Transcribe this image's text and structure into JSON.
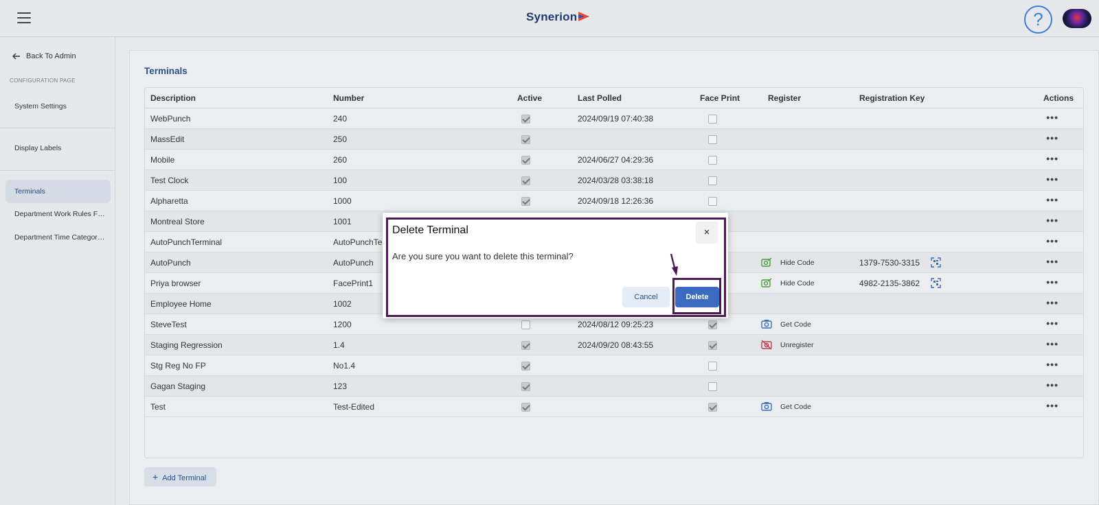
{
  "header": {
    "logo_text": "Synerion",
    "help_symbol": "?"
  },
  "sidebar": {
    "back_label": "Back To Admin",
    "section_label": "CONFIGURATION PAGE",
    "items": [
      {
        "label": "System Settings"
      },
      {
        "label": "Display Labels"
      },
      {
        "label": "Terminals"
      },
      {
        "label": "Department Work Rules Filt..."
      },
      {
        "label": "Department Time Category ..."
      }
    ]
  },
  "main": {
    "title": "Terminals",
    "columns": [
      "Description",
      "Number",
      "Active",
      "Last Polled",
      "Face Print",
      "Register",
      "Registration Key",
      "Actions"
    ],
    "rows": [
      {
        "description": "WebPunch",
        "number": "240",
        "active": true,
        "last_polled": "2024/09/19 07:40:38",
        "face_print": false,
        "register": "",
        "reg_key": ""
      },
      {
        "description": "MassEdit",
        "number": "250",
        "active": true,
        "last_polled": "",
        "face_print": false,
        "register": "",
        "reg_key": ""
      },
      {
        "description": "Mobile",
        "number": "260",
        "active": true,
        "last_polled": "2024/06/27 04:29:36",
        "face_print": false,
        "register": "",
        "reg_key": ""
      },
      {
        "description": "Test Clock",
        "number": "100",
        "active": true,
        "last_polled": "2024/03/28 03:38:18",
        "face_print": false,
        "register": "",
        "reg_key": ""
      },
      {
        "description": "Alpharetta",
        "number": "1000",
        "active": true,
        "last_polled": "2024/09/18 12:26:36",
        "face_print": false,
        "register": "",
        "reg_key": ""
      },
      {
        "description": "Montreal Store",
        "number": "1001",
        "active": null,
        "last_polled": "",
        "face_print": null,
        "register": "",
        "reg_key": ""
      },
      {
        "description": "AutoPunchTerminal",
        "number": "AutoPunchTe",
        "active": null,
        "last_polled": "",
        "face_print": null,
        "register": "",
        "reg_key": ""
      },
      {
        "description": "AutoPunch",
        "number": "AutoPunch",
        "active": null,
        "last_polled": "",
        "face_print": null,
        "register": "Hide Code",
        "reg_key": "1379-7530-3315"
      },
      {
        "description": "Priya browser",
        "number": "FacePrint1",
        "active": null,
        "last_polled": "",
        "face_print": null,
        "register": "Hide Code",
        "reg_key": "4982-2135-3862"
      },
      {
        "description": "Employee Home",
        "number": "1002",
        "active": null,
        "last_polled": "",
        "face_print": null,
        "register": "",
        "reg_key": ""
      },
      {
        "description": "SteveTest",
        "number": "1200",
        "active": false,
        "last_polled": "2024/08/12 09:25:23",
        "face_print": true,
        "register": "Get Code",
        "reg_key": ""
      },
      {
        "description": "Staging Regression",
        "number": "1.4",
        "active": true,
        "last_polled": "2024/09/20 08:43:55",
        "face_print": true,
        "register": "Unregister",
        "reg_key": ""
      },
      {
        "description": "Stg Reg No FP",
        "number": "No1.4",
        "active": true,
        "last_polled": "",
        "face_print": false,
        "register": "",
        "reg_key": ""
      },
      {
        "description": "Gagan Staging",
        "number": "123",
        "active": true,
        "last_polled": "",
        "face_print": false,
        "register": "",
        "reg_key": ""
      },
      {
        "description": "Test",
        "number": "Test-Edited",
        "active": true,
        "last_polled": "",
        "face_print": true,
        "register": "Get Code",
        "reg_key": ""
      }
    ],
    "add_label": "Add Terminal"
  },
  "dialog": {
    "title": "Delete Terminal",
    "message": "Are you sure you want to delete this terminal?",
    "close_symbol": "×",
    "cancel_label": "Cancel",
    "delete_label": "Delete"
  },
  "colors": {
    "accent": "#2c4f86",
    "primary_button": "#3a6bc0",
    "highlight_frame": "#4b1a52",
    "register_green": "#4a9a3c",
    "register_blue": "#3a6bc0",
    "register_red": "#c23b4a"
  }
}
